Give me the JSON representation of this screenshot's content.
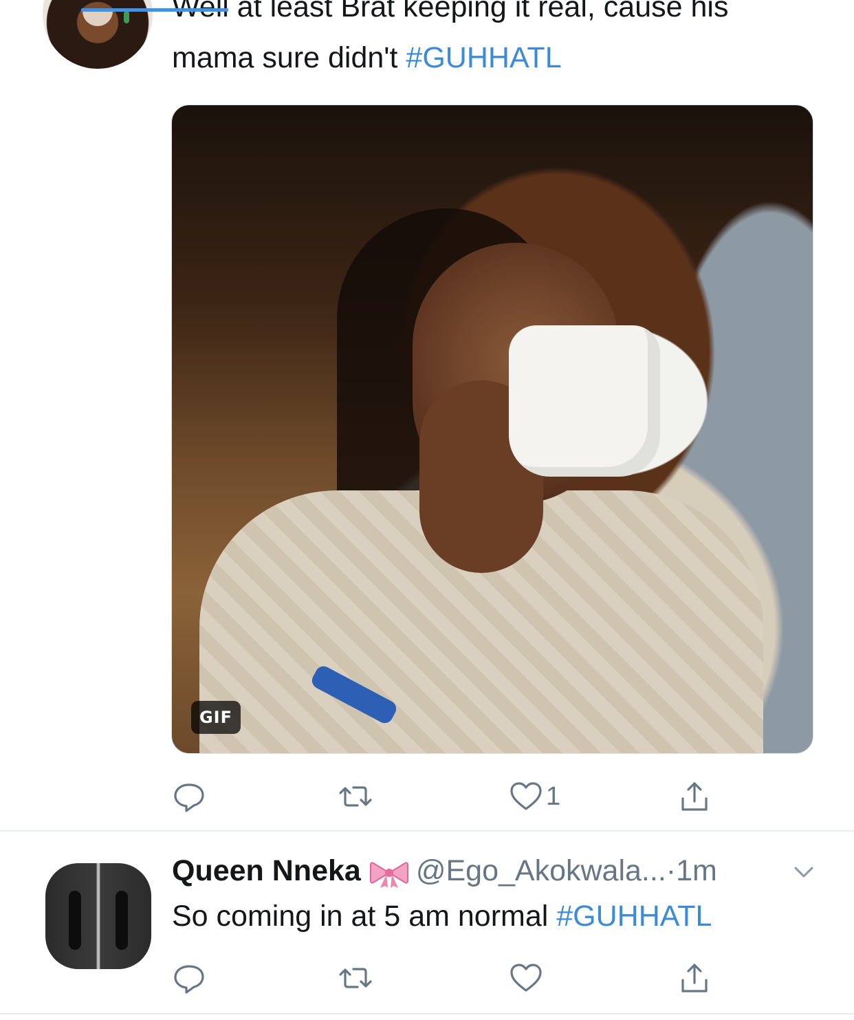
{
  "colors": {
    "text": "#14171a",
    "secondary": "#657786",
    "hashtag": "#3b8bd6",
    "divider": "#e6ecf0",
    "progress": "#4a90d9"
  },
  "tweet1": {
    "text_line1": "Well at least Brat keeping it real, cause his",
    "text_line2_prefix": "mama sure didn't ",
    "hashtag": "#GUHHATL",
    "media_badge": "GIF",
    "actions": {
      "reply_icon": "reply-icon",
      "retweet_icon": "retweet-icon",
      "like_icon": "heart-icon",
      "like_count": "1",
      "share_icon": "share-icon"
    }
  },
  "tweet2": {
    "display_name": "Queen Nneka",
    "name_emoji": "ribbon-bow-icon",
    "handle": "@Ego_Akokwala...",
    "separator": "·",
    "time": "1m",
    "text_prefix": "So coming in at 5 am normal ",
    "hashtag": "#GUHHATL",
    "menu_icon": "chevron-down-icon",
    "actions": {
      "reply_icon": "reply-icon",
      "retweet_icon": "retweet-icon",
      "like_icon": "heart-icon",
      "share_icon": "share-icon"
    }
  }
}
